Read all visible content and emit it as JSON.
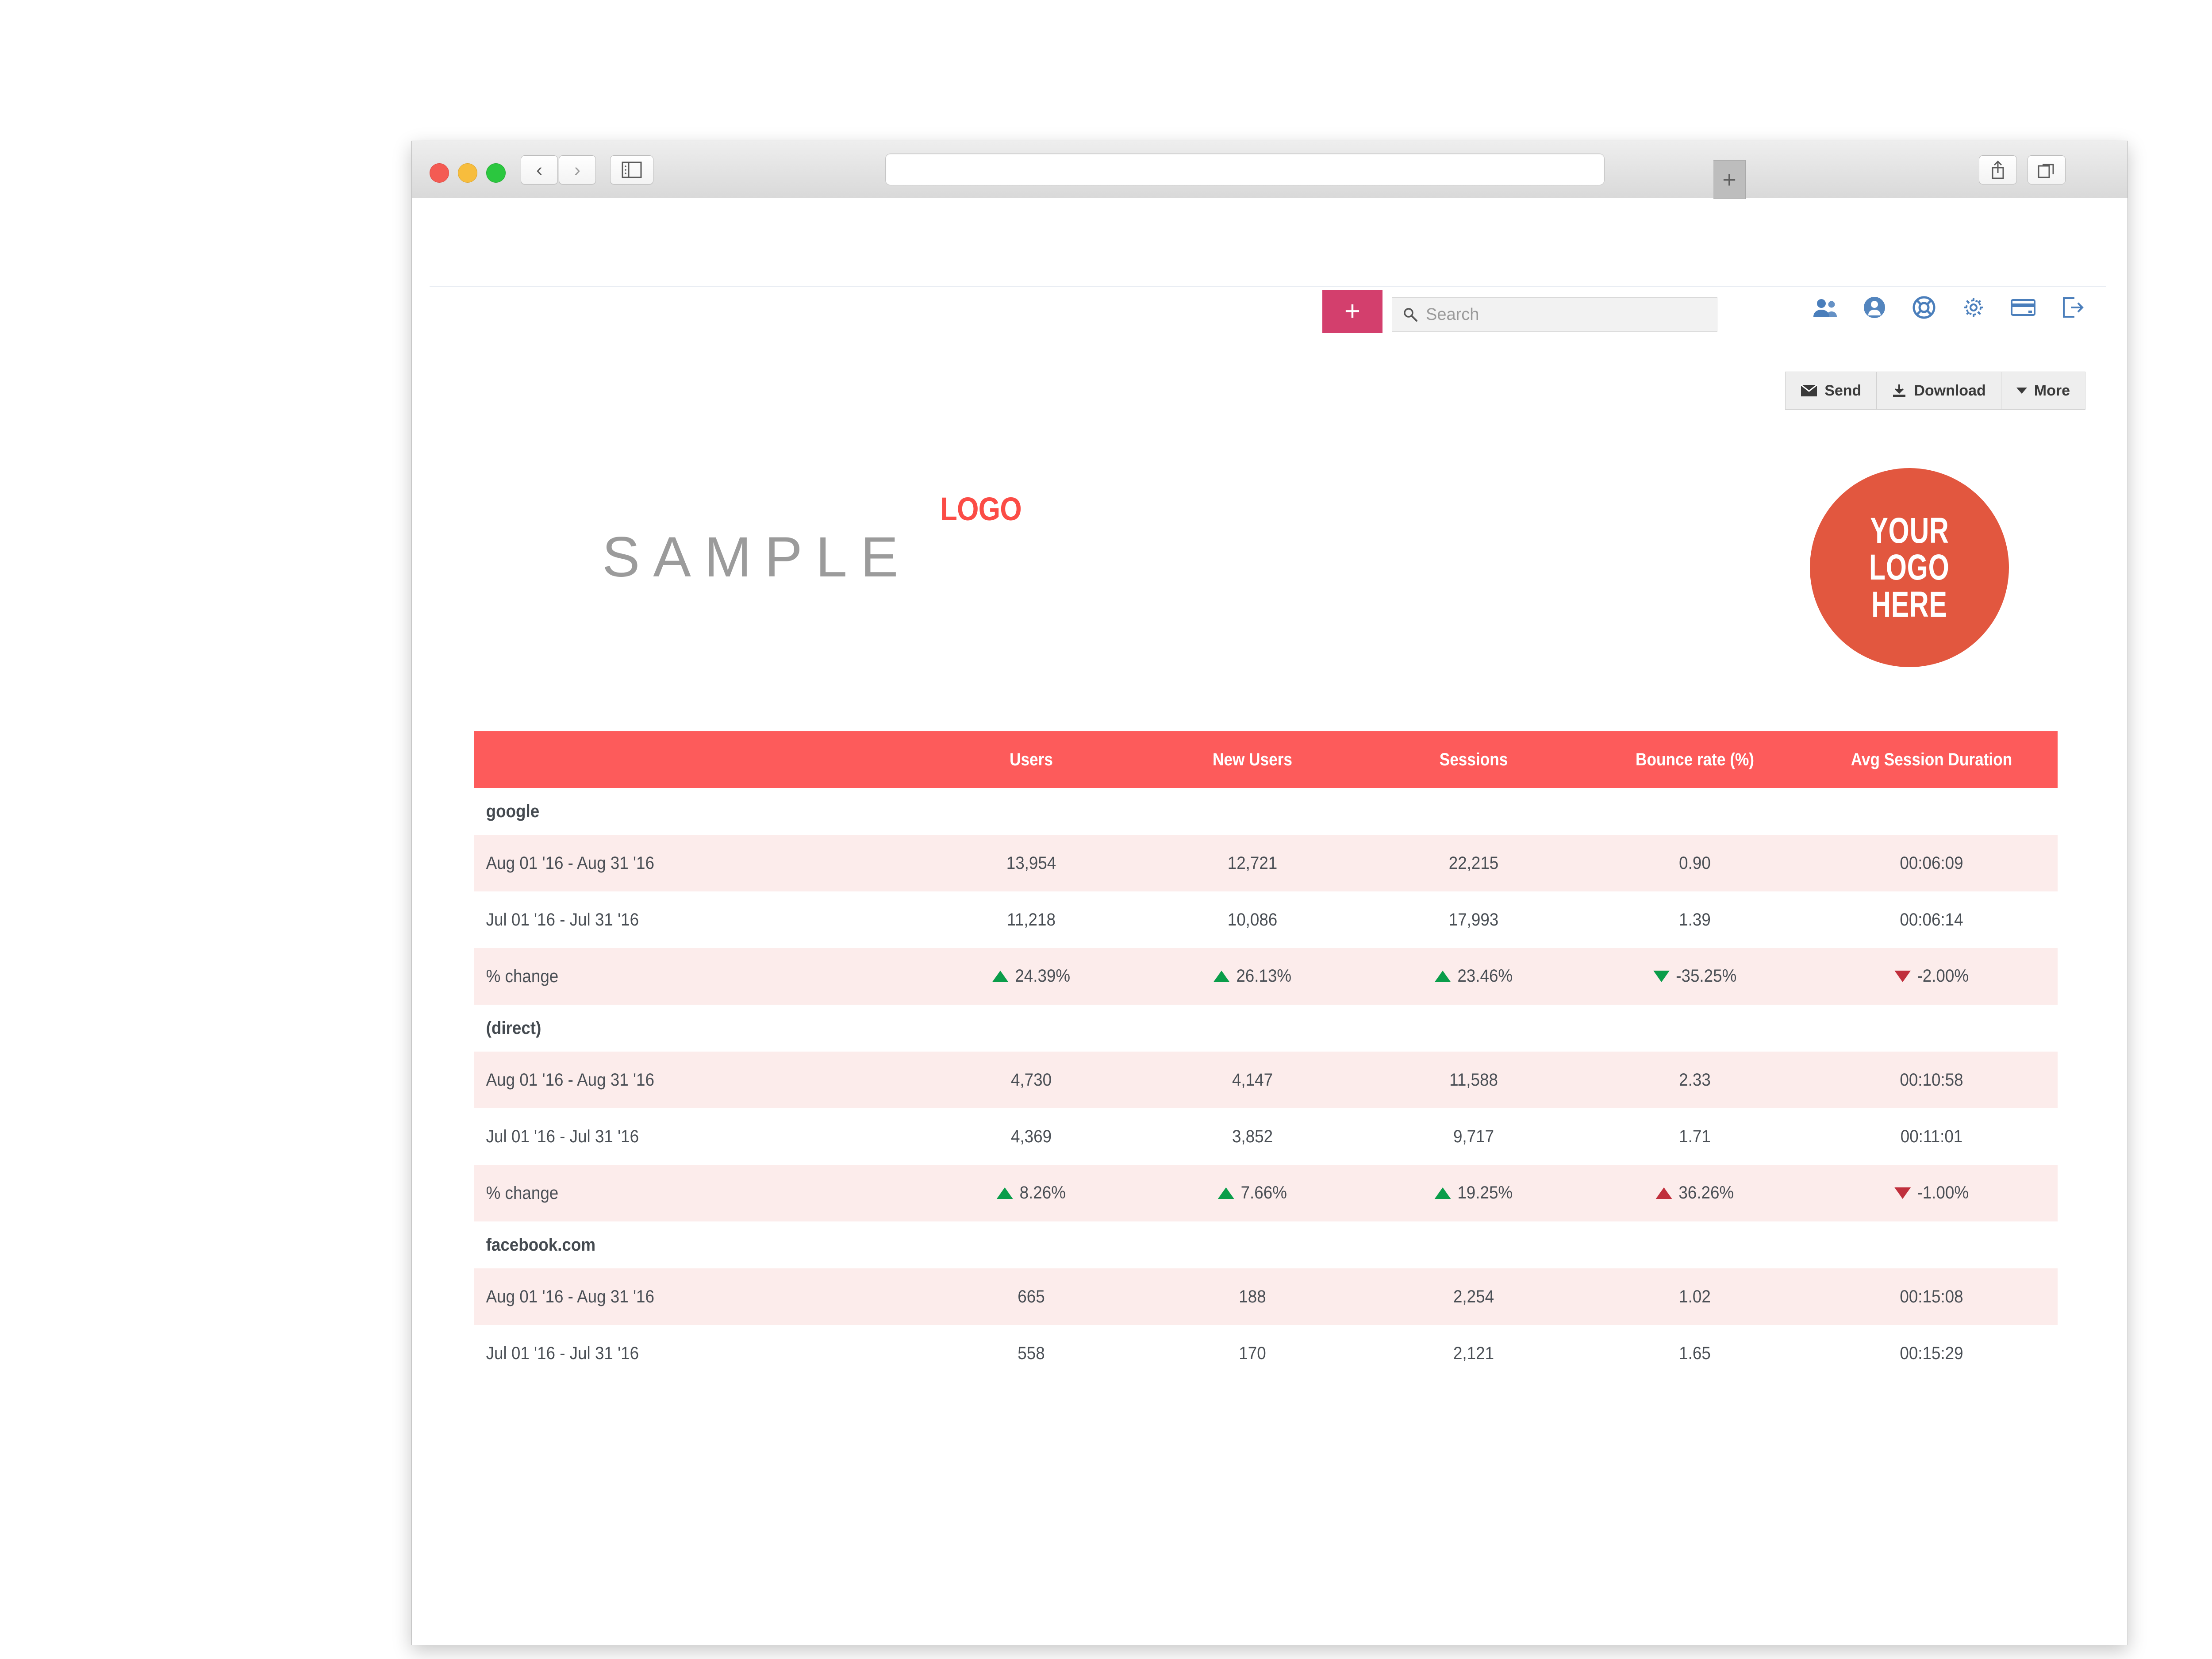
{
  "browser": {
    "traffic_lights": [
      "close",
      "minimize",
      "maximize"
    ],
    "back_icon": "chevron-left-icon",
    "forward_icon": "chevron-right-icon",
    "sidebar_icon": "sidebar-toggle-icon",
    "url_value": "",
    "share_icon": "share-icon",
    "tabs_icon": "show-tabs-icon",
    "new_tab_label": "+"
  },
  "app_header": {
    "add_label": "+",
    "search": {
      "placeholder": "Search",
      "value": "",
      "icon": "search-icon"
    },
    "icons": [
      {
        "name": "users-icon",
        "label": "Users"
      },
      {
        "name": "account-icon",
        "label": "Account"
      },
      {
        "name": "help-lifebuoy-icon",
        "label": "Help"
      },
      {
        "name": "settings-gear-icon",
        "label": "Settings"
      },
      {
        "name": "billing-card-icon",
        "label": "Billing"
      },
      {
        "name": "logout-icon",
        "label": "Log out"
      }
    ],
    "accent_pink": "#d33f6d",
    "icon_blue": "#4a7ebb"
  },
  "toolbar": {
    "send_label": "Send",
    "send_icon": "envelope-icon",
    "download_label": "Download",
    "download_icon": "download-icon",
    "more_label": "More",
    "more_icon": "caret-down-icon"
  },
  "branding": {
    "logo_word": "LOGO",
    "sample_word": "SAMPLE",
    "logo_word_color": "#fb4c46",
    "sample_color": "#9b9b9b",
    "badge": {
      "line1": "YOUR",
      "line2": "LOGO",
      "line3": "HERE",
      "color": "#e2573f"
    }
  },
  "table": {
    "header_color": "#fd5b5b",
    "stripe_color": "#fceceb",
    "columns": [
      "",
      "Users",
      "New Users",
      "Sessions",
      "Bounce rate (%)",
      "Avg Session Duration"
    ],
    "groups": [
      {
        "name": "google",
        "rows": [
          {
            "label": "Aug 01 '16 - Aug 31 '16",
            "values": [
              "13,954",
              "12,721",
              "22,215",
              "0.90",
              "00:06:09"
            ],
            "shade": true
          },
          {
            "label": "Jul 01 '16 - Jul 31 '16",
            "values": [
              "11,218",
              "10,086",
              "17,993",
              "1.39",
              "00:06:14"
            ],
            "shade": false
          },
          {
            "label": "% change",
            "shade": true,
            "is_change": true,
            "changes": [
              {
                "text": "24.39%",
                "dir": "up",
                "tone": "pos"
              },
              {
                "text": "26.13%",
                "dir": "up",
                "tone": "pos"
              },
              {
                "text": "23.46%",
                "dir": "up",
                "tone": "pos"
              },
              {
                "text": "-35.25%",
                "dir": "down",
                "tone": "pos"
              },
              {
                "text": "-2.00%",
                "dir": "down",
                "tone": "neg"
              }
            ]
          }
        ]
      },
      {
        "name": "(direct)",
        "rows": [
          {
            "label": "Aug 01 '16 - Aug 31 '16",
            "values": [
              "4,730",
              "4,147",
              "11,588",
              "2.33",
              "00:10:58"
            ],
            "shade": true
          },
          {
            "label": "Jul 01 '16 - Jul 31 '16",
            "values": [
              "4,369",
              "3,852",
              "9,717",
              "1.71",
              "00:11:01"
            ],
            "shade": false
          },
          {
            "label": "% change",
            "shade": true,
            "is_change": true,
            "changes": [
              {
                "text": "8.26%",
                "dir": "up",
                "tone": "pos"
              },
              {
                "text": "7.66%",
                "dir": "up",
                "tone": "pos"
              },
              {
                "text": "19.25%",
                "dir": "up",
                "tone": "pos"
              },
              {
                "text": "36.26%",
                "dir": "up",
                "tone": "neg"
              },
              {
                "text": "-1.00%",
                "dir": "down",
                "tone": "neg"
              }
            ]
          }
        ]
      },
      {
        "name": "facebook.com",
        "rows": [
          {
            "label": "Aug 01 '16 - Aug 31 '16",
            "values": [
              "665",
              "188",
              "2,254",
              "1.02",
              "00:15:08"
            ],
            "shade": true
          },
          {
            "label": "Jul 01 '16 - Jul 31 '16",
            "values": [
              "558",
              "170",
              "2,121",
              "1.65",
              "00:15:29"
            ],
            "shade": false
          }
        ]
      }
    ]
  }
}
